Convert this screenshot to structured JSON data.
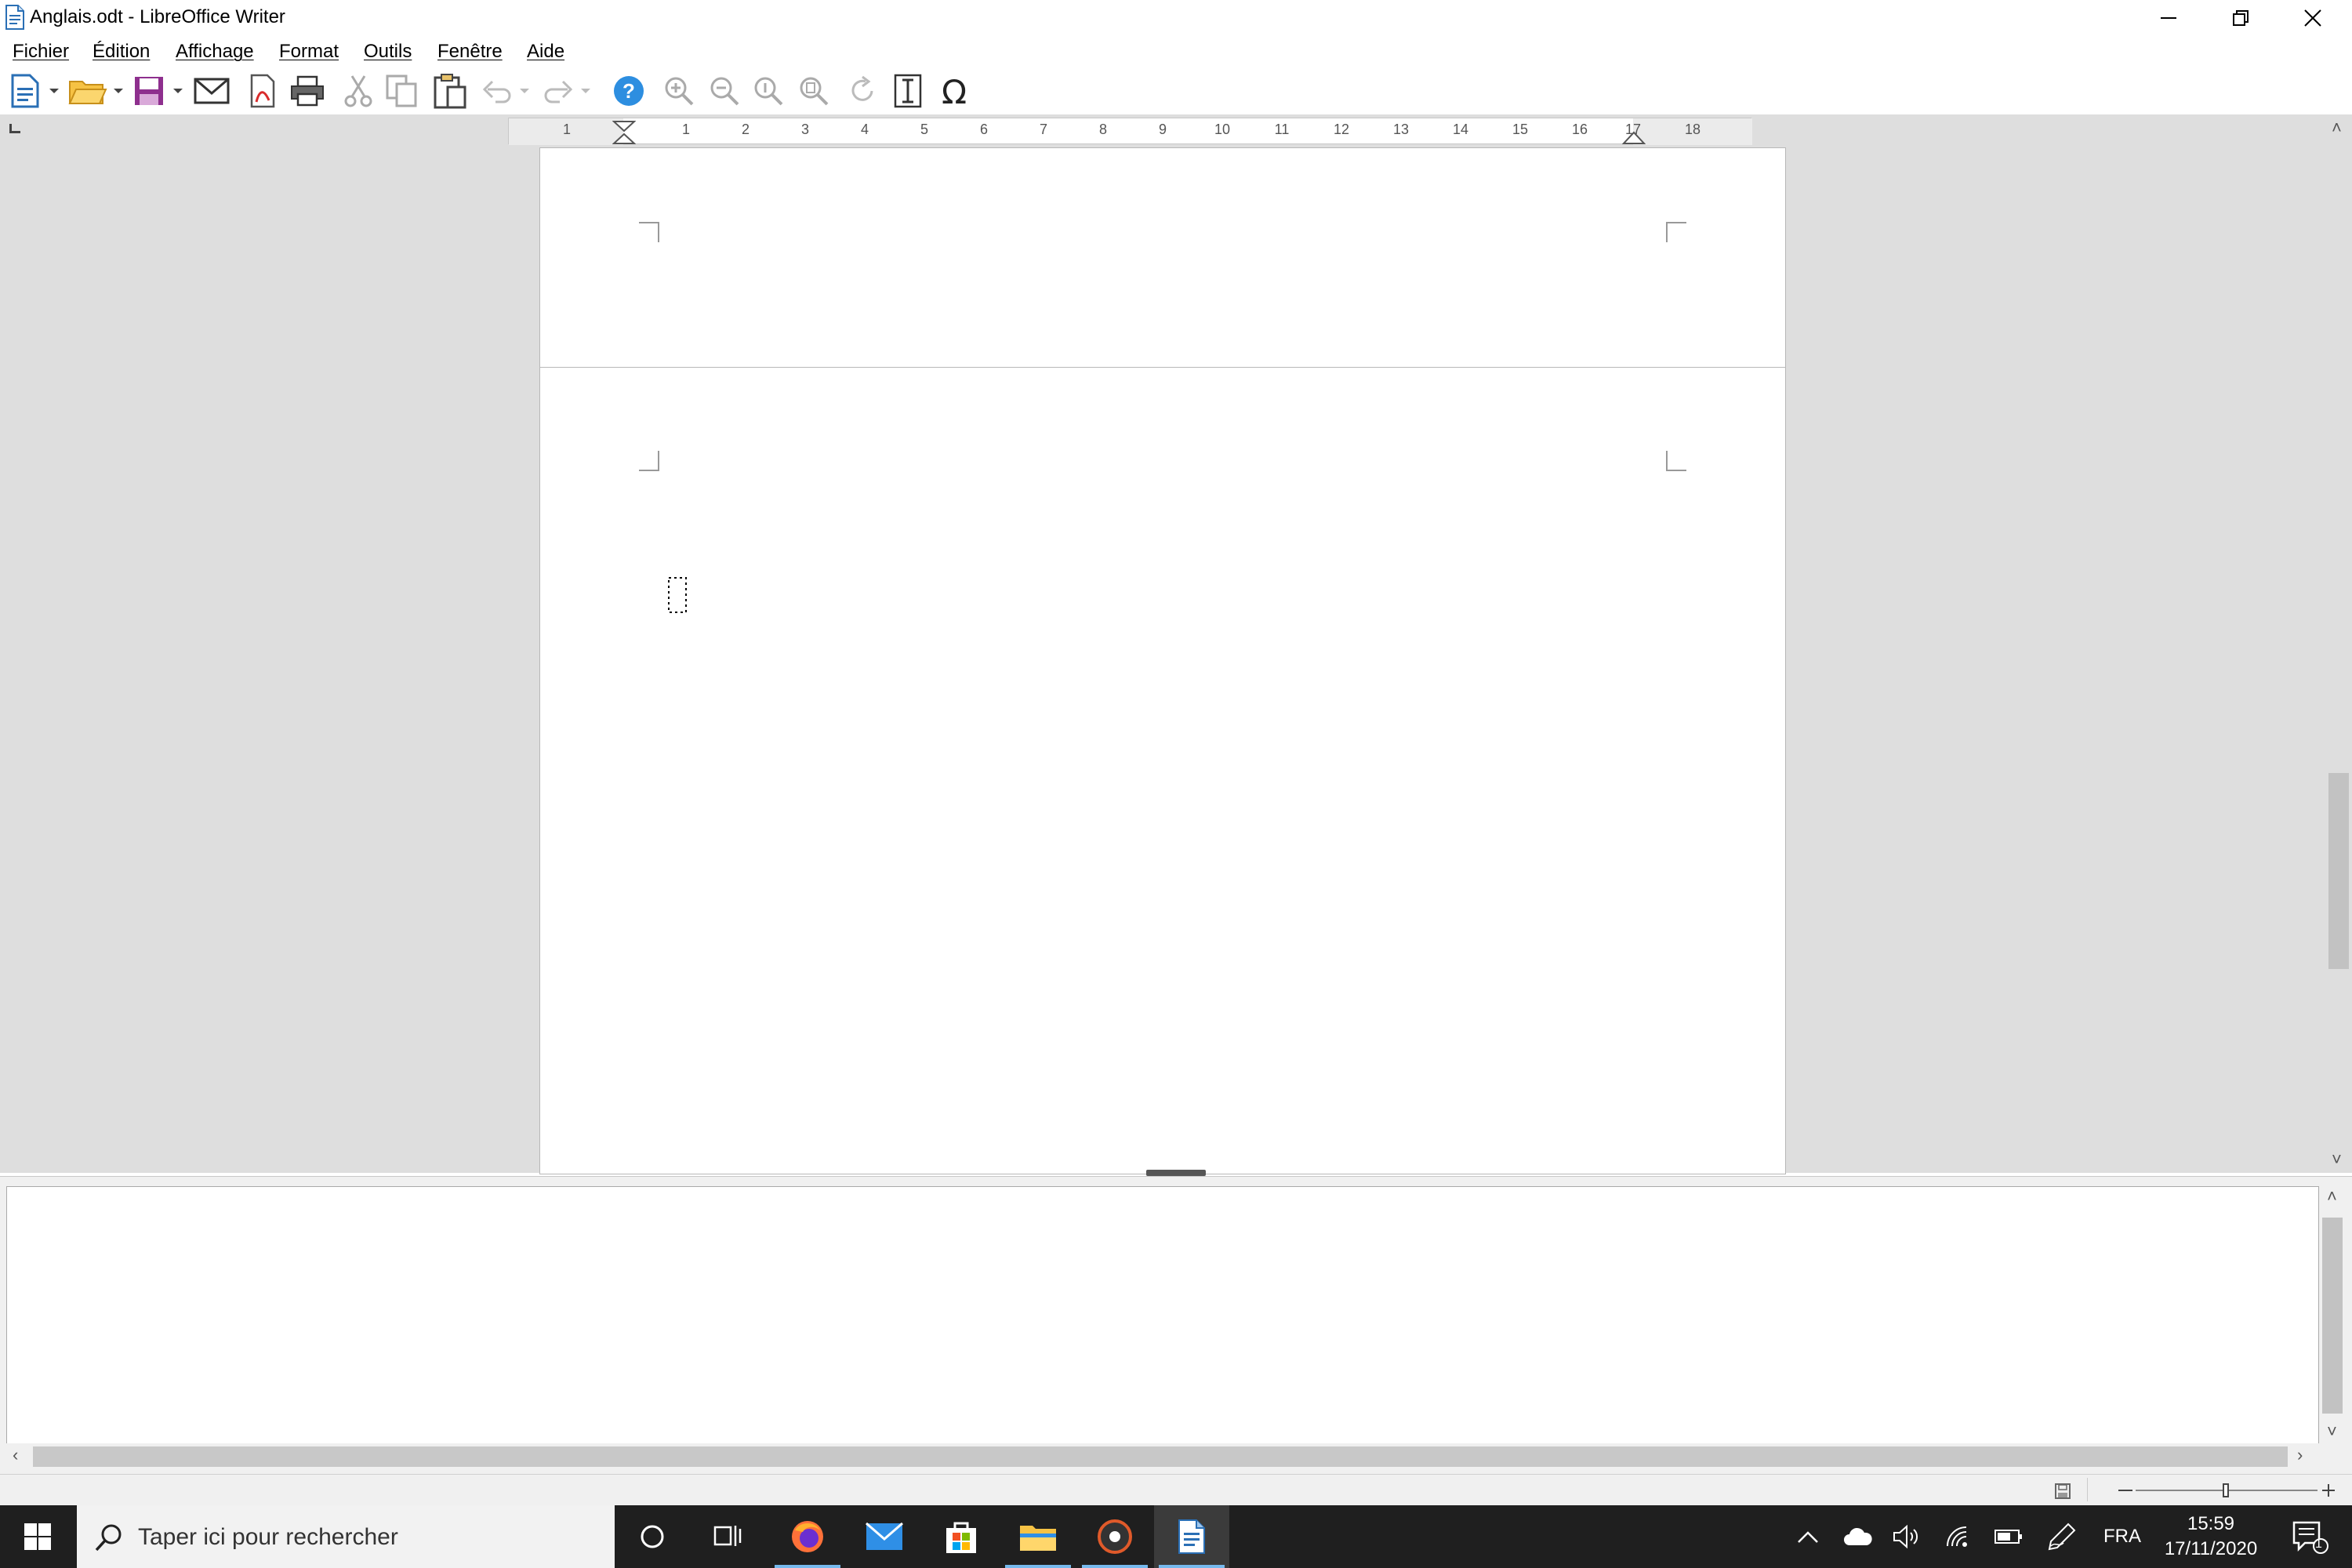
{
  "window": {
    "title": "Anglais.odt - LibreOffice Writer"
  },
  "menu": [
    "Fichier",
    "Édition",
    "Affichage",
    "Format",
    "Outils",
    "Fenêtre",
    "Aide"
  ],
  "ruler": {
    "labels": [
      "1",
      "1",
      "2",
      "3",
      "4",
      "5",
      "6",
      "7",
      "8",
      "9",
      "10",
      "11",
      "12",
      "13",
      "14",
      "15",
      "16",
      "17",
      "18"
    ]
  },
  "taskbar": {
    "search_placeholder": "Taper ici pour rechercher",
    "language": "FRA",
    "time": "15:59",
    "date": "17/11/2020",
    "notifications_count": "1"
  },
  "colors": {
    "taskbar_bg": "#1f1f1f",
    "accent": "#76b9ed",
    "workarea_bg": "#dedede"
  }
}
